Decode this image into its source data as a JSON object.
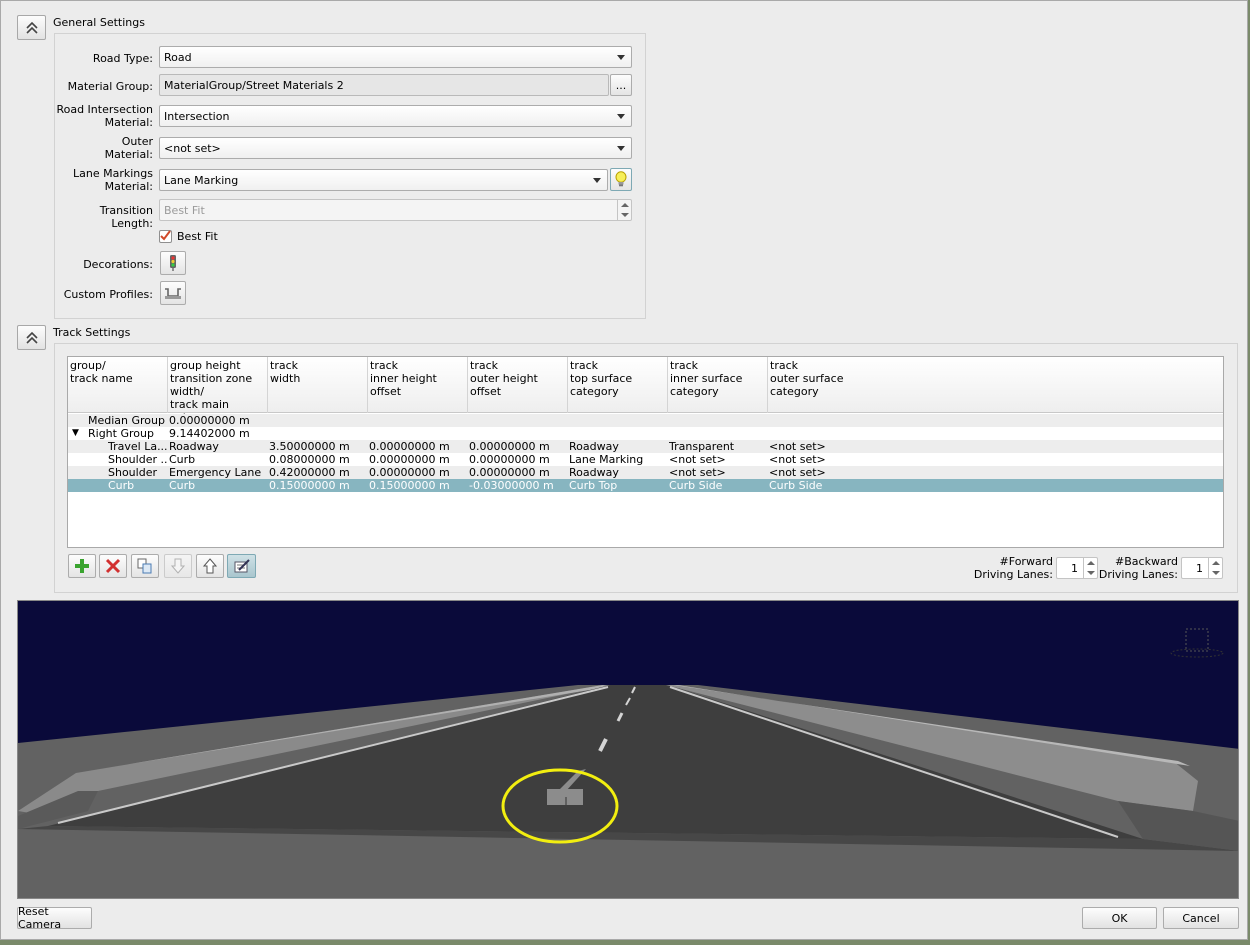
{
  "general": {
    "title": "General Settings",
    "road_type_label": "Road Type:",
    "road_type_value": "Road",
    "material_group_label": "Material Group:",
    "material_group_value": "MaterialGroup/Street Materials 2",
    "browse_label": "...",
    "intersection_label": "Road Intersection\nMaterial:",
    "intersection_value": "Intersection",
    "outer_label": "Outer\nMaterial:",
    "outer_value": "<not set>",
    "lane_markings_label": "Lane Markings\nMaterial:",
    "lane_markings_value": "Lane Marking",
    "transition_label": "Transition Length:",
    "transition_value": "Best Fit",
    "best_fit_label": "Best Fit",
    "best_fit_checked": true,
    "decorations_label": "Decorations:",
    "custom_profiles_label": "Custom Profiles:"
  },
  "track": {
    "title": "Track Settings",
    "columns": [
      "group/\ntrack name",
      "group height\ntransition zone\nwidth/\ntrack main category",
      "track\nwidth",
      "track\ninner height\noffset",
      "track\nouter height\noffset",
      "track\ntop surface\ncategory",
      "track\ninner surface\ncategory",
      "track\nouter surface\ncategory"
    ],
    "rows": [
      {
        "indent": 1,
        "expand": "",
        "cells": [
          "Median Group",
          "0.00000000 m",
          "",
          "",
          "",
          "",
          "",
          ""
        ]
      },
      {
        "indent": 0,
        "expand": "▼",
        "cells": [
          "Right Group",
          "9.14402000 m",
          "",
          "",
          "",
          "",
          "",
          ""
        ]
      },
      {
        "indent": 2,
        "expand": "",
        "cells": [
          "Travel La...",
          "Roadway",
          "3.50000000 m",
          "0.00000000 m",
          "0.00000000 m",
          "Roadway",
          "Transparent",
          "<not set>"
        ]
      },
      {
        "indent": 2,
        "expand": "",
        "cells": [
          "Shoulder ...",
          "Curb",
          "0.08000000 m",
          "0.00000000 m",
          "0.00000000 m",
          "Lane Marking",
          "<not set>",
          "<not set>"
        ]
      },
      {
        "indent": 2,
        "expand": "",
        "cells": [
          "Shoulder",
          "Emergency Lane",
          "0.42000000 m",
          "0.00000000 m",
          "0.00000000 m",
          "Roadway",
          "<not set>",
          "<not set>"
        ]
      },
      {
        "indent": 2,
        "expand": "",
        "cells": [
          "Curb",
          "Curb",
          "0.15000000 m",
          "0.15000000 m",
          "-0.03000000 m",
          "Curb Top",
          "Curb Side",
          "Curb Side"
        ]
      }
    ],
    "selected_row": 5,
    "forward_label": "#Forward\nDriving Lanes:",
    "forward_value": "1",
    "backward_label": "#Backward\nDriving Lanes:",
    "backward_value": "1"
  },
  "footer": {
    "reset_camera": "Reset Camera",
    "ok": "OK",
    "cancel": "Cancel"
  },
  "colors": {
    "sky": "#0a0a3a",
    "selection": "#87b5c0",
    "highlight_circle": "#f2ee10"
  }
}
